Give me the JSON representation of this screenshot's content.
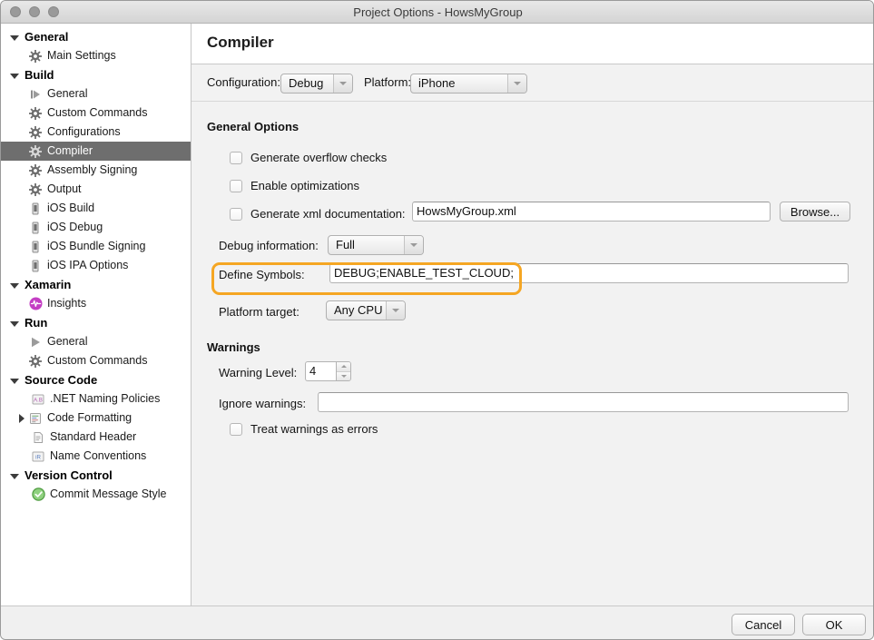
{
  "window": {
    "title": "Project Options - HowsMyGroup",
    "traffic_lights": [
      "close",
      "minimize",
      "maximize"
    ]
  },
  "sidebar": {
    "nodes": [
      {
        "kind": "group",
        "label": "General",
        "expanded": true
      },
      {
        "kind": "leaf",
        "label": "Main Settings",
        "icon": "gear-icon"
      },
      {
        "kind": "group",
        "label": "Build",
        "expanded": true
      },
      {
        "kind": "leaf",
        "label": "General",
        "icon": "build-general-icon"
      },
      {
        "kind": "leaf",
        "label": "Custom Commands",
        "icon": "gear-icon"
      },
      {
        "kind": "leaf",
        "label": "Configurations",
        "icon": "gear-icon"
      },
      {
        "kind": "leaf",
        "label": "Compiler",
        "icon": "gear-icon",
        "selected": true
      },
      {
        "kind": "leaf",
        "label": "Assembly Signing",
        "icon": "gear-icon"
      },
      {
        "kind": "leaf",
        "label": "Output",
        "icon": "gear-icon"
      },
      {
        "kind": "leaf",
        "label": "iOS Build",
        "icon": "device-icon"
      },
      {
        "kind": "leaf",
        "label": "iOS Debug",
        "icon": "device-icon"
      },
      {
        "kind": "leaf",
        "label": "iOS Bundle Signing",
        "icon": "device-icon"
      },
      {
        "kind": "leaf",
        "label": "iOS IPA Options",
        "icon": "device-icon"
      },
      {
        "kind": "group",
        "label": "Xamarin",
        "expanded": true
      },
      {
        "kind": "leaf",
        "label": "Insights",
        "icon": "insights-icon"
      },
      {
        "kind": "group",
        "label": "Run",
        "expanded": true
      },
      {
        "kind": "leaf",
        "label": "General",
        "icon": "play-icon"
      },
      {
        "kind": "leaf",
        "label": "Custom Commands",
        "icon": "gear-icon"
      },
      {
        "kind": "group",
        "label": "Source Code",
        "expanded": true
      },
      {
        "kind": "leaf",
        "label": ".NET Naming Policies",
        "icon": "ab-icon"
      },
      {
        "kind": "leaf",
        "label": "Code Formatting",
        "icon": "code-format-icon",
        "collapsed_arrow": true
      },
      {
        "kind": "leaf",
        "label": "Standard Header",
        "icon": "document-icon"
      },
      {
        "kind": "leaf",
        "label": "Name Conventions",
        "icon": "ir-icon"
      },
      {
        "kind": "group",
        "label": "Version Control",
        "expanded": true
      },
      {
        "kind": "leaf",
        "label": "Commit Message Style",
        "icon": "check-circle-icon"
      }
    ]
  },
  "main": {
    "page_title": "Compiler",
    "config_bar": {
      "configuration_label": "Configuration:",
      "configuration_value": "Debug",
      "platform_label": "Platform:",
      "platform_value": "iPhone"
    },
    "general_options": {
      "section_title": "General Options",
      "generate_overflow_checks": {
        "label": "Generate overflow checks",
        "checked": false
      },
      "enable_optimizations": {
        "label": "Enable optimizations",
        "checked": false
      },
      "generate_xml_documentation": {
        "label": "Generate xml documentation:",
        "checked": false
      },
      "xml_doc_value": "HowsMyGroup.xml",
      "browse_label": "Browse...",
      "debug_information_label": "Debug information:",
      "debug_information_value": "Full",
      "define_symbols_label": "Define Symbols:",
      "define_symbols_value": "DEBUG;ENABLE_TEST_CLOUD;",
      "platform_target_label": "Platform target:",
      "platform_target_value": "Any CPU"
    },
    "warnings": {
      "section_title": "Warnings",
      "warning_level_label": "Warning Level:",
      "warning_level_value": "4",
      "ignore_warnings_label": "Ignore warnings:",
      "ignore_warnings_value": "",
      "treat_warnings_as_errors": {
        "label": "Treat warnings as errors",
        "checked": false
      }
    }
  },
  "footer": {
    "cancel_label": "Cancel",
    "ok_label": "OK"
  },
  "colors": {
    "highlight": "#f5a623",
    "selection": "#6e6e6e",
    "insights_badge": "#c43ec4",
    "commit_check": "#5bbd52"
  }
}
